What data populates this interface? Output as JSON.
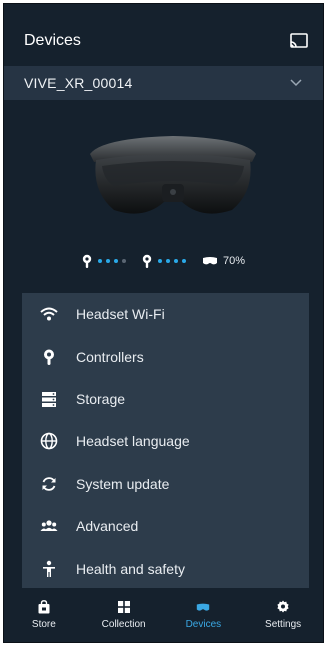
{
  "header": {
    "title": "Devices"
  },
  "device_selector": {
    "selected": "VIVE_XR_00014"
  },
  "status": {
    "controller_left_level": 3,
    "controller_right_level": 4,
    "headset_battery": "70%"
  },
  "menu": {
    "items": [
      {
        "label": "Headset Wi-Fi",
        "icon": "wifi-icon"
      },
      {
        "label": "Controllers",
        "icon": "controller-icon"
      },
      {
        "label": "Storage",
        "icon": "storage-icon"
      },
      {
        "label": "Headset language",
        "icon": "globe-icon"
      },
      {
        "label": "System update",
        "icon": "sync-icon"
      },
      {
        "label": "Advanced",
        "icon": "people-icon"
      },
      {
        "label": "Health and safety",
        "icon": "person-icon"
      }
    ]
  },
  "bottom_nav": {
    "items": [
      {
        "label": "Store",
        "icon": "store-icon"
      },
      {
        "label": "Collection",
        "icon": "collection-icon"
      },
      {
        "label": "Devices",
        "icon": "devices-icon",
        "active": true
      },
      {
        "label": "Settings",
        "icon": "gear-icon"
      }
    ]
  },
  "colors": {
    "background": "#15212d",
    "panel": "#2d3c4b",
    "accent": "#3aa8e4",
    "selector": "#263444"
  }
}
